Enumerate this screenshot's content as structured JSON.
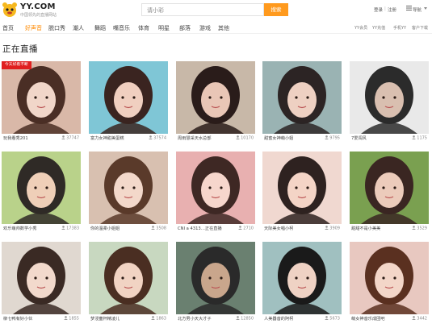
{
  "header": {
    "logo_text": "YY.COM",
    "logo_sub": "中国领先的直播网站",
    "search_placeholder": "请小彩",
    "search_button": "搜索",
    "login": "登录",
    "separator": "|",
    "register": "注册",
    "menu_label": "导航"
  },
  "nav": {
    "items": [
      "首页",
      "好声音",
      "脱口秀",
      "潮人",
      "舞蹈",
      "嘴音乐",
      "体育",
      "明星",
      "部落",
      "游戏",
      "其他"
    ],
    "active_index": 1,
    "right_links": [
      "YY会员",
      "YY充值",
      "手机YY",
      "客户下载"
    ]
  },
  "section": {
    "title": "正在直播"
  },
  "colors": {
    "accent": "#ff9a1e",
    "badge": "#e02020"
  },
  "streams": [
    {
      "name": "玩我看秀201",
      "viewers": "37747",
      "badge": "今天好看不断"
    },
    {
      "name": "富力女神甜美蛋糕",
      "viewers": "37574"
    },
    {
      "name": "周雨慧采天水总部",
      "viewers": "10170"
    },
    {
      "name": "甜蜜女神萌小姐",
      "viewers": "9795"
    },
    {
      "name": "7爱闯风",
      "viewers": "1175"
    },
    {
      "name": "欢乐萌帅数学小秀",
      "viewers": "17383"
    },
    {
      "name": "你的温柔小姐姐",
      "viewers": "3508"
    },
    {
      "name": "CNI a 4313…正在直播",
      "viewers": "2710"
    },
    {
      "name": "天际美女唱小柯",
      "viewers": "3909"
    },
    {
      "name": "甜甜不是小美美",
      "viewers": "3529"
    },
    {
      "name": "柳七鸭有好小伙",
      "viewers": "1855"
    },
    {
      "name": "梦浸童杯精凌儿",
      "viewers": "1863"
    },
    {
      "name": "北方男小天大才子",
      "viewers": "12850"
    },
    {
      "name": "人美器音的阿柯",
      "viewers": "5673"
    },
    {
      "name": "萌女神音乐成团吧",
      "viewers": "3442"
    }
  ]
}
